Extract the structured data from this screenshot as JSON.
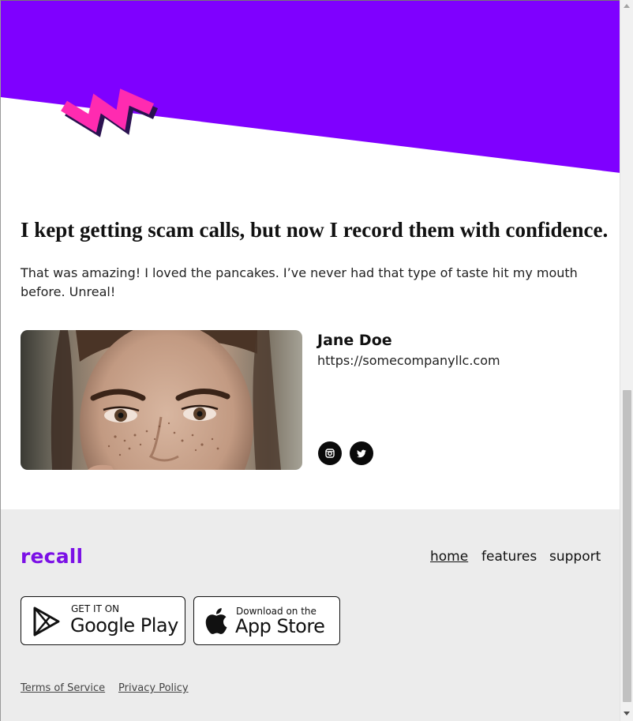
{
  "colors": {
    "hero_purple": "#7f00ff",
    "zigzag_pink": "#ff2bb0",
    "zigzag_shadow": "#2a1250",
    "logo_purple": "#7b10e6",
    "footer_bg": "#ececec"
  },
  "testimonial": {
    "quote": "I kept getting scam calls, but now I record them with confidence.",
    "body": "That was amazing! I loved the pancakes. I’ve never had that type of taste hit my mouth before. Unreal!",
    "author": {
      "name": "Jane Doe",
      "url": "https://somecompanyllc.com",
      "photo_icon": "person-portrait-photo"
    },
    "social": [
      {
        "name": "instagram",
        "icon": "instagram-icon"
      },
      {
        "name": "twitter",
        "icon": "twitter-icon"
      }
    ]
  },
  "footer": {
    "logo": "recall",
    "nav": [
      {
        "label": "home",
        "active": true
      },
      {
        "label": "features",
        "active": false
      },
      {
        "label": "support",
        "active": false
      }
    ],
    "stores": {
      "google_play": {
        "small": "GET IT ON",
        "big": "Google Play",
        "icon": "google-play-icon"
      },
      "app_store": {
        "small": "Download on the",
        "big": "App Store",
        "icon": "apple-icon"
      }
    },
    "legal": {
      "terms": "Terms of Service",
      "privacy": "Privacy Policy"
    }
  }
}
